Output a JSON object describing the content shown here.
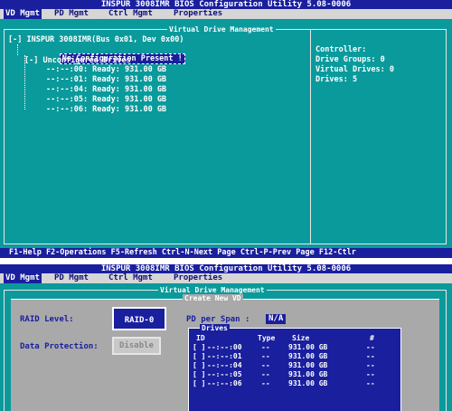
{
  "screen1": {
    "title": "INSPUR 3008IMR BIOS Configuration Utility 5.08-0006",
    "menu": [
      "VD Mgmt",
      "PD Mgmt",
      "Ctrl Mgmt",
      "Properties"
    ],
    "panel_title": "Virtual Drive Management",
    "tree": {
      "root": "[-] INSPUR 3008IMR(Bus 0x01, Dev 0x00)",
      "no_config": "No Configuration Present !",
      "unconfigured": "[-] Unconfigured Drives",
      "drives": [
        "--:--:00: Ready: 931.00 GB",
        "--:--:01: Ready: 931.00 GB",
        "--:--:04: Ready: 931.00 GB",
        "--:--:05: Ready: 931.00 GB",
        "--:--:06: Ready: 931.00 GB"
      ]
    },
    "controller": {
      "heading": "Controller:",
      "drive_groups": "Drive Groups: 0",
      "virtual_drives": "Virtual Drives: 0",
      "drives": "Drives: 5"
    },
    "status": "F1-Help F2-Operations F5-Refresh Ctrl-N-Next Page Ctrl-P-Prev Page F12-Ctlr"
  },
  "screen2": {
    "title": "INSPUR 3008IMR BIOS Configuration Utility 5.08-0006",
    "menu": [
      "VD Mgmt",
      "PD Mgmt",
      "Ctrl Mgmt",
      "Properties"
    ],
    "panel_title": "Virtual Drive Management",
    "dialog_title": "Create New VD",
    "raid_level_label": "RAID Level:",
    "raid_level_value": "RAID-0",
    "data_protection_label": "Data Protection:",
    "data_protection_value": "Disable",
    "pd_per_span_label": "PD per Span :",
    "pd_per_span_value": "N/A",
    "drives_title": "Drives",
    "drives_header": {
      "id": "ID",
      "type": "Type",
      "size": "Size",
      "num": "#"
    },
    "drives": [
      {
        "check": "[ ]",
        "id": "--:--:00",
        "type": "--",
        "size": "931.00 GB",
        "num": "--"
      },
      {
        "check": "[ ]",
        "id": "--:--:01",
        "type": "--",
        "size": "931.00 GB",
        "num": "--"
      },
      {
        "check": "[ ]",
        "id": "--:--:04",
        "type": "--",
        "size": "931.00 GB",
        "num": "--"
      },
      {
        "check": "[ ]",
        "id": "--:--:05",
        "type": "--",
        "size": "931.00 GB",
        "num": "--"
      },
      {
        "check": "[ ]",
        "id": "--:--:06",
        "type": "--",
        "size": "931.00 GB",
        "num": "--"
      }
    ]
  }
}
